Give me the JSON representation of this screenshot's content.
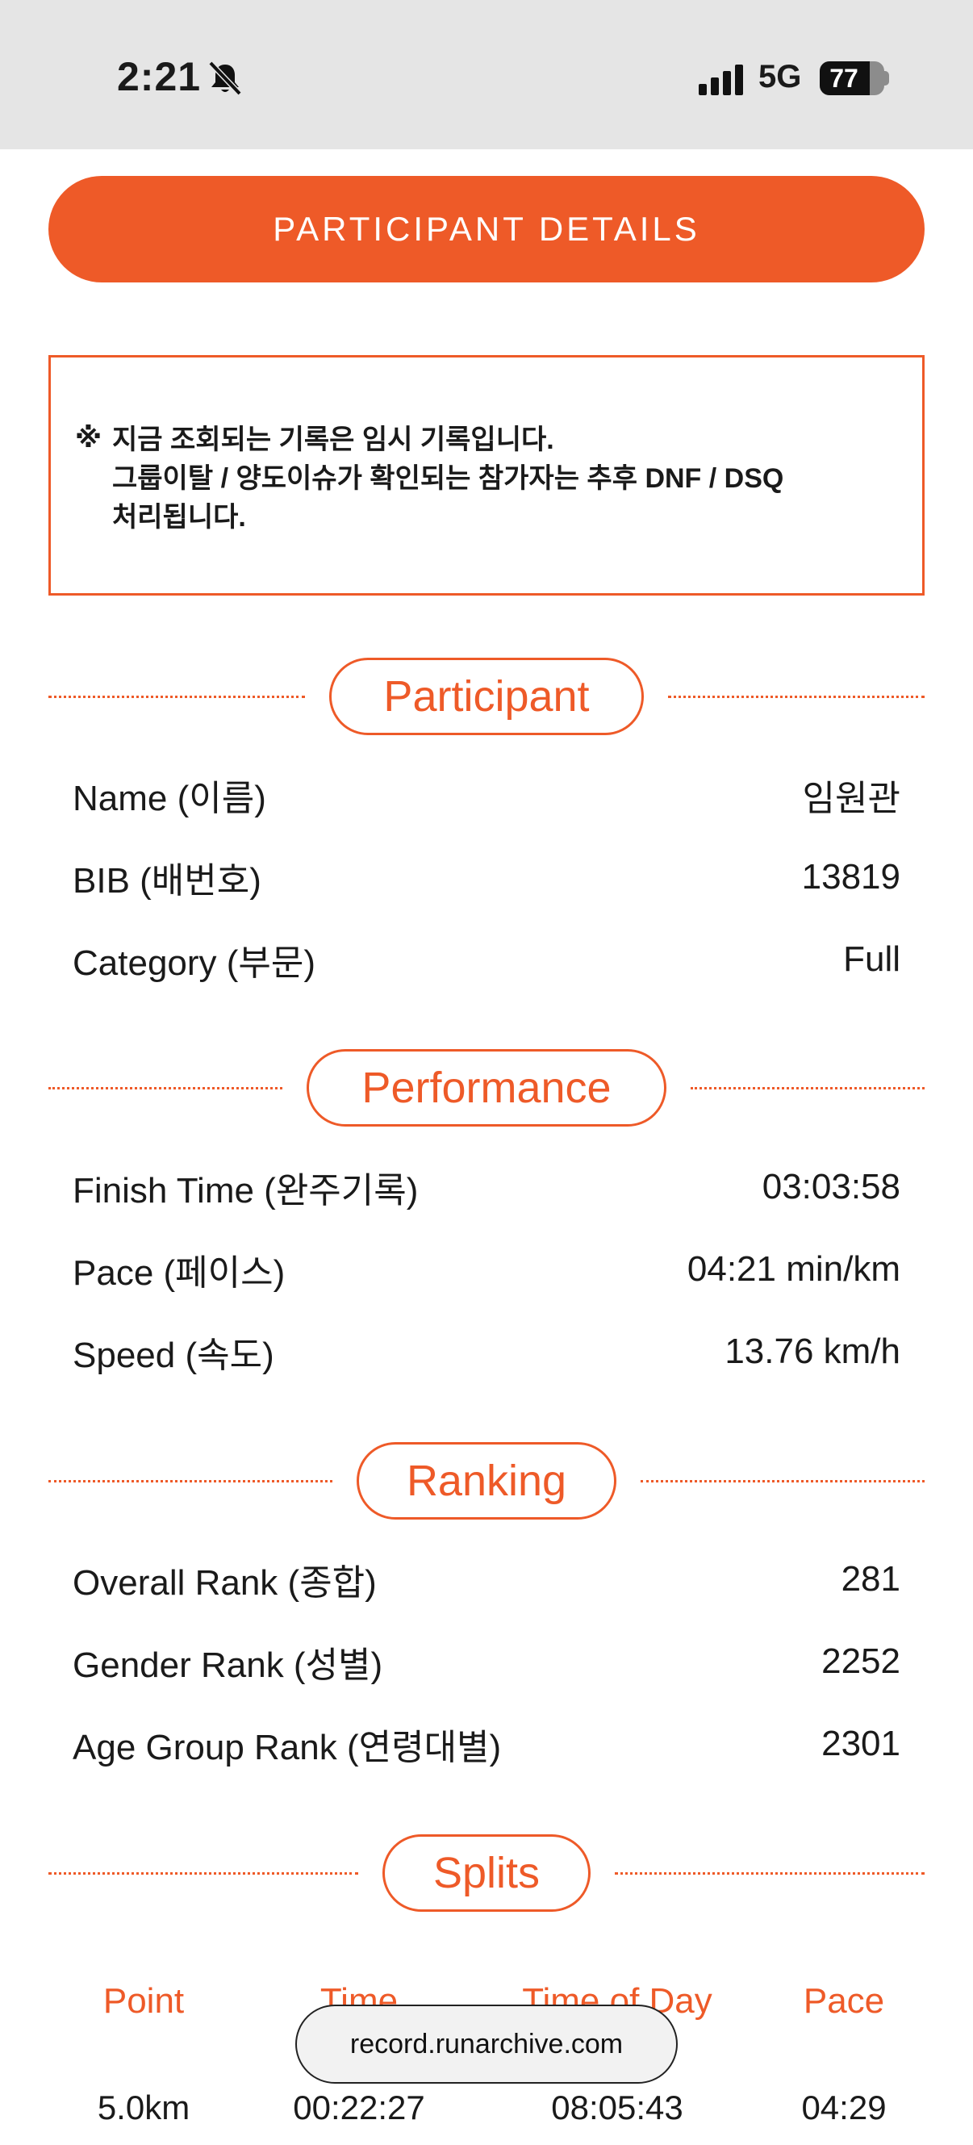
{
  "status_bar": {
    "time": "2:21",
    "network": "5G",
    "battery_percent": "77",
    "battery_level": 0.77
  },
  "header": {
    "title": "PARTICIPANT DETAILS"
  },
  "notice": {
    "mark": "※",
    "text": "지금 조회되는 기록은 임시 기록입니다.\n그룹이탈 / 양도이슈가 확인되는 참가자는 추후 DNF / DSQ\n처리됩니다."
  },
  "sections": {
    "participant": {
      "title": "Participant",
      "rows": [
        {
          "label": "Name (이름)",
          "value": "임원관"
        },
        {
          "label": "BIB (배번호)",
          "value": "13819"
        },
        {
          "label": "Category (부문)",
          "value": "Full"
        }
      ]
    },
    "performance": {
      "title": "Performance",
      "rows": [
        {
          "label": "Finish Time (완주기록)",
          "value": "03:03:58"
        },
        {
          "label": "Pace (페이스)",
          "value": "04:21 min/km"
        },
        {
          "label": "Speed (속도)",
          "value": "13.76 km/h"
        }
      ]
    },
    "ranking": {
      "title": "Ranking",
      "rows": [
        {
          "label": "Overall Rank (종합)",
          "value": "281"
        },
        {
          "label": "Gender Rank (성별)",
          "value": "2252"
        },
        {
          "label": "Age Group Rank (연령대별)",
          "value": "2301"
        }
      ]
    },
    "splits": {
      "title": "Splits",
      "columns": [
        "Point",
        "Time",
        "Time of Day",
        "Pace"
      ],
      "rows": [
        {
          "point": "5.0km",
          "time": "00:22:27",
          "time_of_day": "08:05:43",
          "pace": "04:29"
        }
      ]
    }
  },
  "browser": {
    "url": "record.runarchive.com"
  },
  "colors": {
    "accent": "#ee5a28",
    "status_bar_bg": "#e5e5e5"
  }
}
